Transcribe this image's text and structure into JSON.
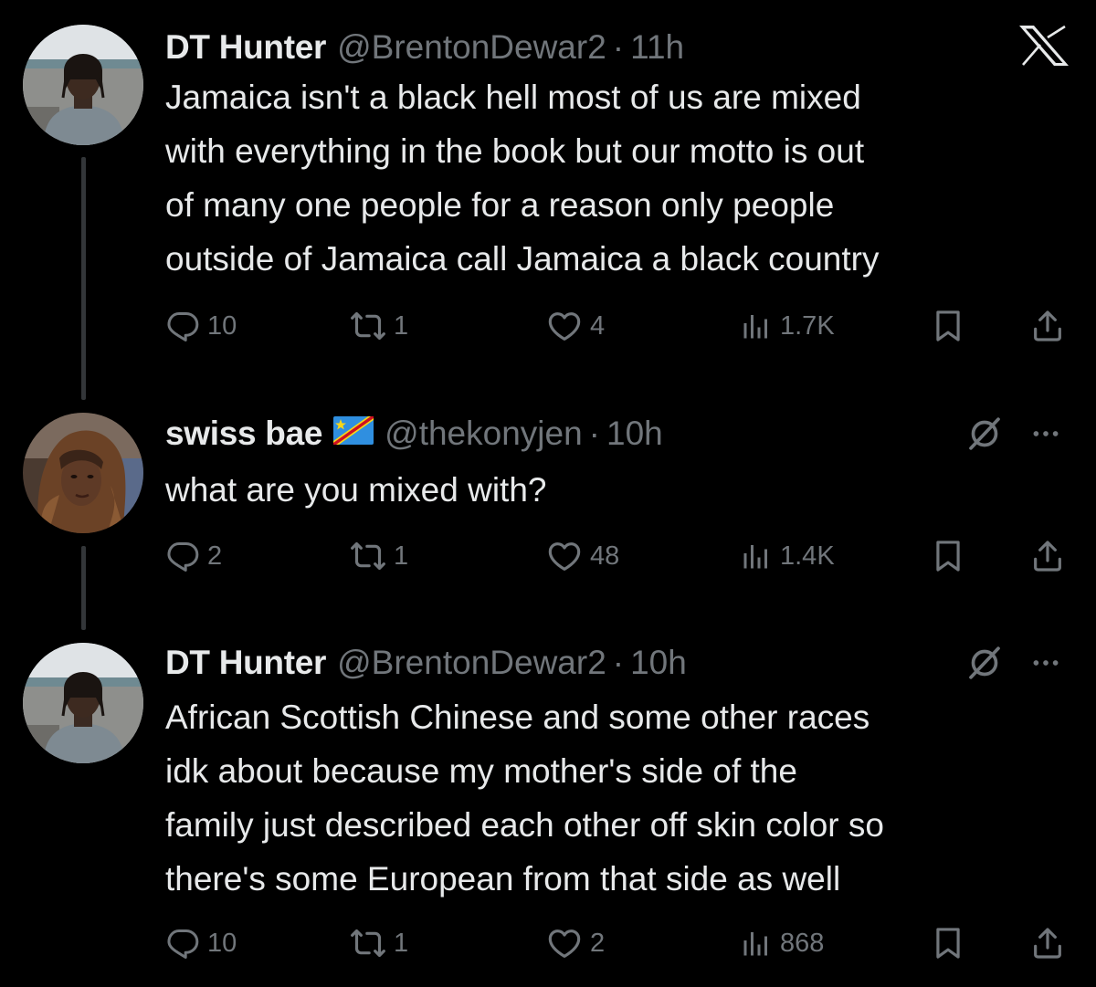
{
  "brand": {
    "icon": "x-logo-icon"
  },
  "colors": {
    "background": "#000000",
    "text_primary": "#e7e9ea",
    "text_secondary": "#71767b",
    "thread_line": "#333639"
  },
  "tweets": [
    {
      "display_name": "DT Hunter",
      "flag_icon": "",
      "handle": "@BrentonDewar2",
      "separator": "·",
      "time": "11h",
      "text": "Jamaica isn't a black hell most of us are mixed\nwith everything in the book but our motto is out\nof many one people for a reason only people\noutside of Jamaica call Jamaica a black country",
      "replies": "10",
      "reposts": "1",
      "likes": "4",
      "views": "1.7K",
      "icons": [
        "reply-icon",
        "repost-icon",
        "like-icon",
        "views-icon",
        "bookmark-icon",
        "share-icon"
      ]
    },
    {
      "display_name": "swiss bae",
      "flag_icon": "dr-congo-flag-icon",
      "handle": "@thekonyjen",
      "separator": "·",
      "time": "10h",
      "text": "what are you mixed with?",
      "replies": "2",
      "reposts": "1",
      "likes": "48",
      "views": "1.4K",
      "top_right_icons": [
        "grok-icon",
        "more-icon"
      ],
      "icons": [
        "reply-icon",
        "repost-icon",
        "like-icon",
        "views-icon",
        "bookmark-icon",
        "share-icon"
      ]
    },
    {
      "display_name": "DT Hunter",
      "flag_icon": "",
      "handle": "@BrentonDewar2",
      "separator": "·",
      "time": "10h",
      "text": "African Scottish Chinese and some other races\nidk about because my mother's side of the\nfamily just described each other off skin color so\nthere's some European from that side as well",
      "replies": "10",
      "reposts": "1",
      "likes": "2",
      "views": "868",
      "top_right_icons": [
        "grok-icon",
        "more-icon"
      ],
      "icons": [
        "reply-icon",
        "repost-icon",
        "like-icon",
        "views-icon",
        "bookmark-icon",
        "share-icon"
      ]
    }
  ]
}
